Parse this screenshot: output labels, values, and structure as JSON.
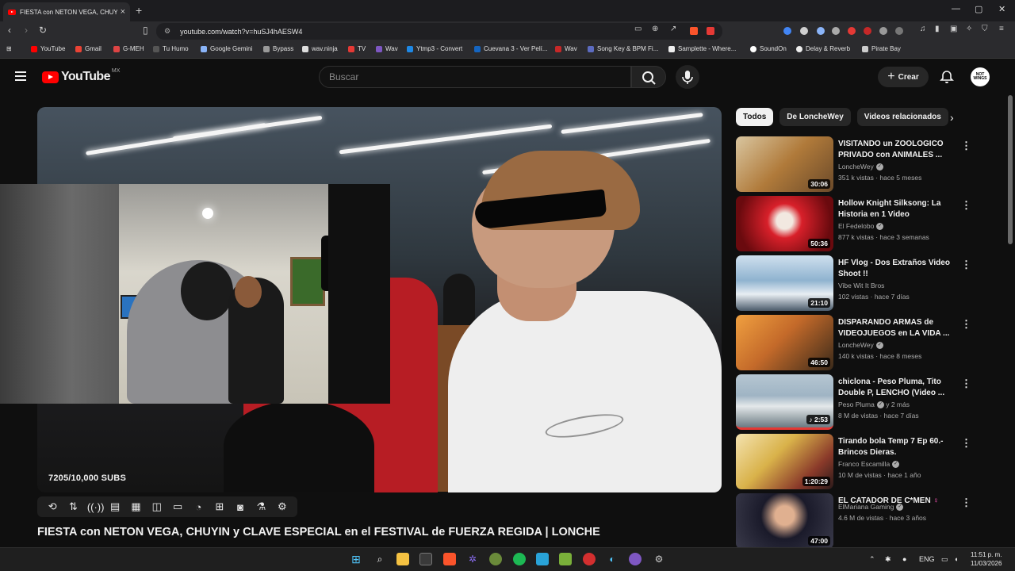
{
  "browser": {
    "tab_title": "FIESTA con NETON VEGA, CHUY",
    "tab_close": "×",
    "new_tab": "+",
    "url": "youtube.com/watch?v=huSJ4hAESW4",
    "window_controls": [
      "—",
      "▢",
      "✕"
    ]
  },
  "bookmarks": [
    {
      "label": "YouTube",
      "color": "#ff0000"
    },
    {
      "label": "Gmail",
      "color": "#ea4335"
    },
    {
      "label": "G-MEH",
      "color": "#d44"
    },
    {
      "label": "Tu Humo",
      "color": "#555"
    },
    {
      "label": "Google Gemini",
      "color": "#8ab4f8"
    },
    {
      "label": "Bypass",
      "color": "#999"
    },
    {
      "label": "wav.ninja",
      "color": "#ddd"
    },
    {
      "label": "TV",
      "color": "#e53935"
    },
    {
      "label": "Wav",
      "color": "#7e57c2"
    },
    {
      "label": "Ytmp3 - Convert",
      "color": "#1e88e5"
    },
    {
      "label": "Cuevana 3 - Ver Pelí...",
      "color": "#1565c0"
    },
    {
      "label": "Wav",
      "color": "#c62828"
    },
    {
      "label": "Song Key & BPM Fi...",
      "color": "#5c6bc0"
    },
    {
      "label": "Samplette - Where...",
      "color": "#eee"
    },
    {
      "label": "SoundOn",
      "color": "#fff"
    },
    {
      "label": "Delay & Reverb",
      "color": "#eee"
    },
    {
      "label": "Pirate Bay",
      "color": "#ccc"
    }
  ],
  "youtube": {
    "logo_text": "YouTube",
    "region": "MX",
    "search_placeholder": "Buscar",
    "create_label": "Crear",
    "avatar_text": "NOT WINGS"
  },
  "video": {
    "overlay_text": "7205/10,000 SUBS",
    "title": "FIESTA con NETON VEGA, CHUYIN y CLAVE ESPECIAL en el FESTIVAL de FUERZA REGIDA | LONCHE",
    "controls": [
      "⟲",
      "⇅",
      "((·))",
      "▤",
      "▦",
      "◫",
      "▭",
      "◔",
      "⊞",
      "◙",
      "⚗",
      "⚙"
    ]
  },
  "chips": [
    "Todos",
    "De LoncheWey",
    "Videos relacionados"
  ],
  "recommendations": [
    {
      "title": "VISITANDO un ZOOLOGICO PRIVADO con ANIMALES ...",
      "channel": "LoncheWey",
      "verified": true,
      "meta": "351 k vistas · hace 5 meses",
      "duration": "30:06",
      "thumb_color": "#b07a3a"
    },
    {
      "title": "Hollow Knight Silksong: La Historia en 1 Video",
      "channel": "El Fedelobo",
      "verified": true,
      "meta": "877 k vistas · hace 3 semanas",
      "duration": "50:36",
      "thumb_color": "#b3121a"
    },
    {
      "title": "HF Vlog - Dos Extraños Video Shoot !!",
      "channel": "Vibe Wit It Bros",
      "verified": false,
      "meta": "102 vistas · hace 7 días",
      "duration": "21:10",
      "thumb_color": "#8fb3cf"
    },
    {
      "title": "DISPARANDO ARMAS de VIDEOJUEGOS en LA VIDA ...",
      "channel": "LoncheWey",
      "verified": true,
      "meta": "140 k vistas · hace 8 meses",
      "duration": "46:50",
      "thumb_color": "#c46a2a"
    },
    {
      "title": "chiclona - Peso Pluma, Tito Double P, LENCHO (Video ...",
      "channel": "Peso Pluma",
      "verified": true,
      "channel_suffix": "y 2 más",
      "meta": "8 M de vistas · hace 7 días",
      "duration": "♪ 2:53",
      "thumb_color": "#9fb4c4"
    },
    {
      "title": "Tirando bola Temp 7 Ep 60.- Brincos Dieras.",
      "channel": "Franco Escamilla",
      "verified": true,
      "meta": "10 M de vistas · hace 1 año",
      "duration": "1:20:29",
      "thumb_color": "#d9b24a"
    },
    {
      "title": "EL CATADOR DE C*MEN",
      "channel": "ElMariana Gaming",
      "verified": true,
      "meta": "4.6 M de vistas · hace 3 años",
      "duration": "47:00",
      "thumb_color": "#2a2a3a"
    }
  ],
  "taskbar": {
    "language": "ENG",
    "time": "11:51 p. m.",
    "date": "11/03/2026"
  }
}
